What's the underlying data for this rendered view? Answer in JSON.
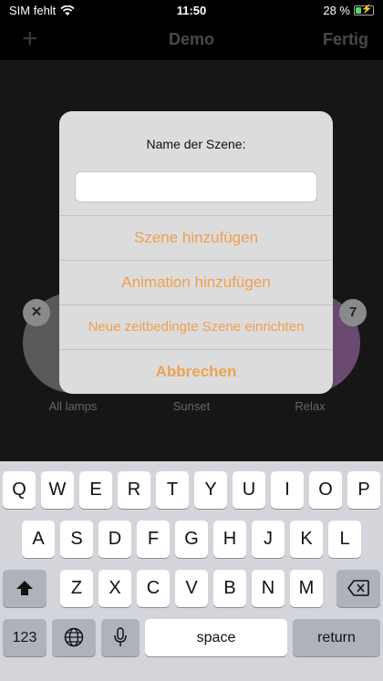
{
  "status_bar": {
    "carrier": "SIM fehlt",
    "time": "11:50",
    "battery": "28 %"
  },
  "nav": {
    "add_symbol": "+",
    "title": "Demo",
    "done": "Fertig"
  },
  "scenes": [
    {
      "label": "All lamps",
      "color": "#5a5a5a"
    },
    {
      "label": "Sunset",
      "color": "#6a5540"
    },
    {
      "label": "Relax",
      "color": "#6a4a70"
    }
  ],
  "badges": {
    "delete": "✕",
    "count": "7"
  },
  "alert": {
    "title": "Name der Szene:",
    "input_value": "",
    "buttons": [
      "Szene hinzufügen",
      "Animation hinzufügen",
      "Neue zeitbedingte Szene einrichten",
      "Abbrechen"
    ]
  },
  "keyboard": {
    "row1": [
      "Q",
      "W",
      "E",
      "R",
      "T",
      "Y",
      "U",
      "I",
      "O",
      "P"
    ],
    "row2": [
      "A",
      "S",
      "D",
      "F",
      "G",
      "H",
      "J",
      "K",
      "L"
    ],
    "row3": [
      "Z",
      "X",
      "C",
      "V",
      "B",
      "N",
      "M"
    ],
    "numbers": "123",
    "space": "space",
    "return": "return"
  },
  "colors": {
    "accent": "#f0a050",
    "alert_bg": "#dcdcdc",
    "keyboard_bg": "#d3d5da"
  }
}
